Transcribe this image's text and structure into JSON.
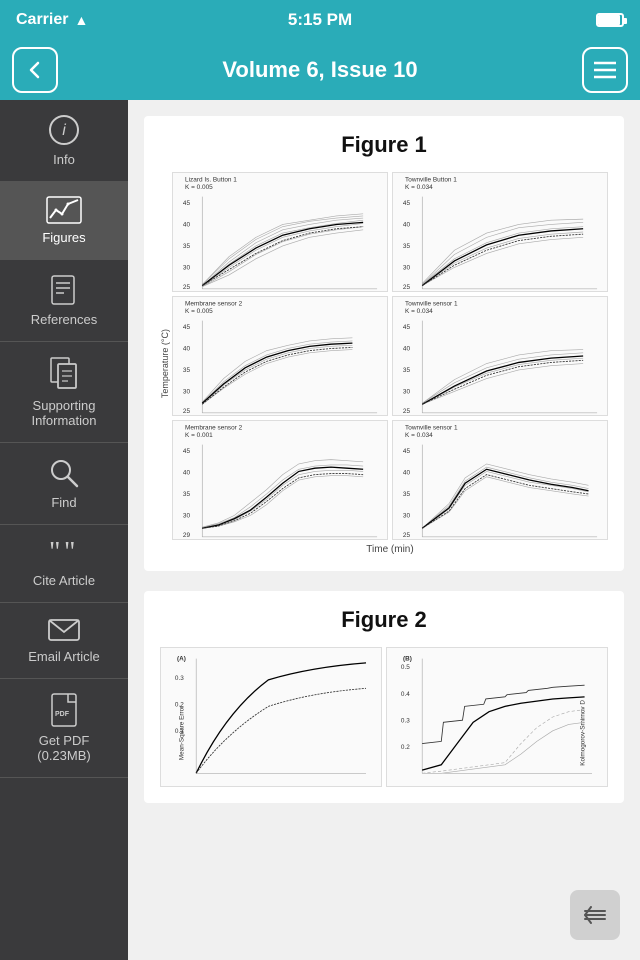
{
  "status_bar": {
    "carrier": "Carrier",
    "time": "5:15 PM"
  },
  "nav": {
    "title": "Volume 6, Issue 10",
    "back_label": "<",
    "menu_label": "≡"
  },
  "sidebar": {
    "items": [
      {
        "id": "info",
        "label": "Info",
        "icon": "ℹ",
        "active": false
      },
      {
        "id": "figures",
        "label": "Figures",
        "icon": "📊",
        "active": true
      },
      {
        "id": "references",
        "label": "References",
        "icon": "📋",
        "active": false
      },
      {
        "id": "supporting",
        "label": "Supporting\nInformation",
        "icon": "📄",
        "active": false
      },
      {
        "id": "find",
        "label": "Find",
        "icon": "🔍",
        "active": false
      },
      {
        "id": "cite",
        "label": "Cite Article",
        "icon": "❝",
        "active": false
      },
      {
        "id": "email",
        "label": "Email Article",
        "icon": "✉",
        "active": false
      },
      {
        "id": "pdf",
        "label": "Get PDF\n(0.23MB)",
        "icon": "📑",
        "active": false
      }
    ]
  },
  "figures": [
    {
      "id": "figure1",
      "title": "Figure 1",
      "subtitle": "Temperature (°C)",
      "x_label": "Time (min)",
      "subplots": [
        {
          "title": "Lizard Is. Button 1",
          "subtitle": "K = 0.005",
          "x_max": 12
        },
        {
          "title": "Townville Button 1",
          "subtitle": "K = 0.034",
          "x_max": 30
        },
        {
          "title": "Membrane sensor 2",
          "subtitle": "K = 0.005",
          "x_max": 10
        },
        {
          "title": "Townville sensor 1",
          "subtitle": "K = 0.034",
          "x_max": 30
        },
        {
          "title": "Membrane sensor 2",
          "subtitle": "K = 0.001",
          "x_max": 10
        },
        {
          "title": "Townville sensor 1",
          "subtitle": "K = 0.034",
          "x_max": 30
        }
      ]
    },
    {
      "id": "figure2",
      "title": "Figure 2",
      "subplots": [
        {
          "label": "(A)",
          "y_label": "Mean-Square Error"
        },
        {
          "label": "(B)",
          "y_label": "Kolmogorov-Smirnov D"
        }
      ]
    }
  ],
  "colors": {
    "teal": "#2AACB8",
    "sidebar_bg": "#3A3A3C",
    "sidebar_active": "#555555"
  }
}
